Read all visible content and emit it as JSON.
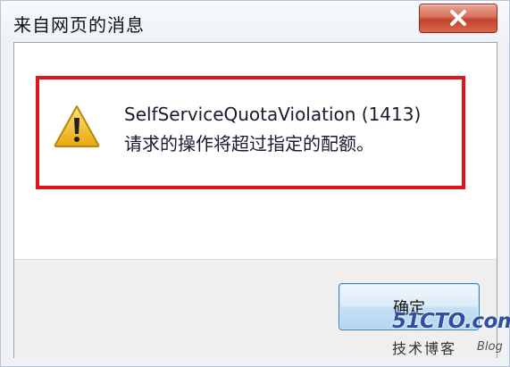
{
  "dialog": {
    "title": "来自网页的消息",
    "message_line1": "SelfServiceQuotaViolation (1413)",
    "message_line2": "请求的操作将超过指定的配额。",
    "ok_label": "确定",
    "icon": "warning-icon"
  },
  "watermark": {
    "logo": "51CTO.com",
    "subtitle": "技术博客",
    "blog": "Blog"
  },
  "colors": {
    "highlight_border": "#e0141c",
    "close_button": "#c5432d",
    "warning_yellow": "#f5c518"
  }
}
